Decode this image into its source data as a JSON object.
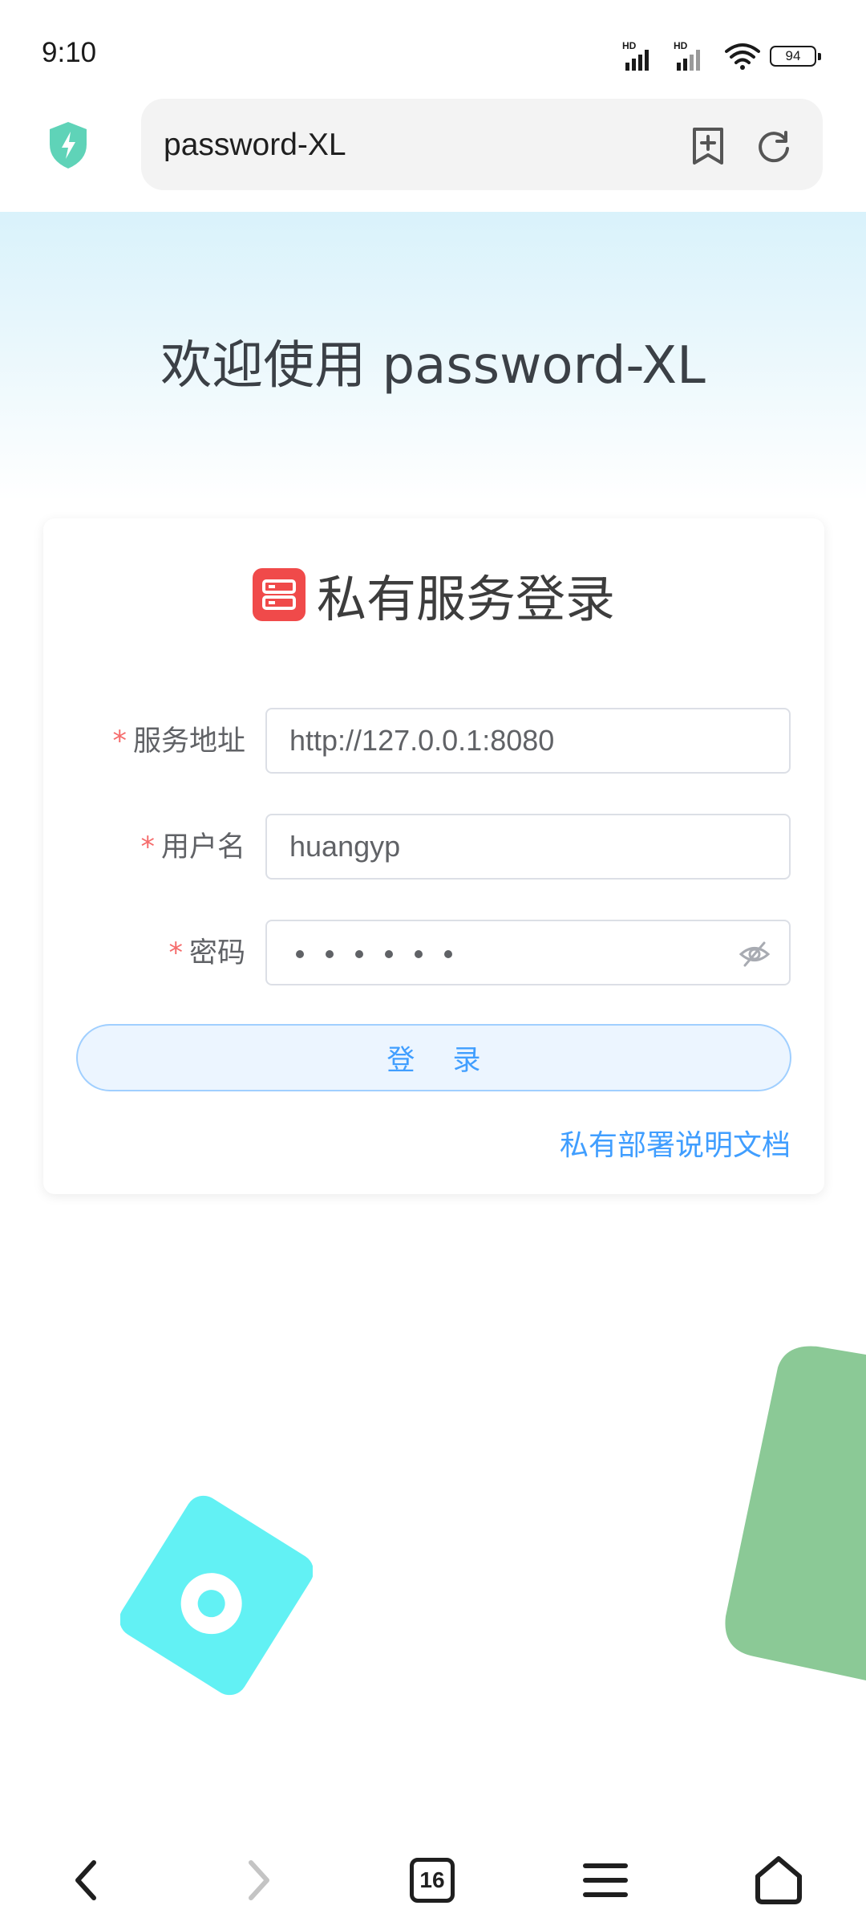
{
  "status_bar": {
    "time": "9:10",
    "signal1_label": "HD",
    "signal2_label": "HD",
    "battery_level": "94"
  },
  "browser": {
    "address": "password-XL",
    "icons": [
      "shield-icon",
      "bookmark-add-icon",
      "reload-icon"
    ]
  },
  "page": {
    "welcome_title": "欢迎使用 password-XL",
    "card_title": "私有服务登录",
    "form": {
      "required_mark": "*",
      "server_label": "服务地址",
      "server_value": "http://127.0.0.1:8080",
      "username_label": "用户名",
      "username_value": "huangyp",
      "password_label": "密码",
      "password_length": 6
    },
    "login_button": "登 录",
    "docs_link": "私有部署说明文档"
  },
  "colors": {
    "accent": "#409eff",
    "required": "#f56c6c",
    "server_icon": "#f04a4a",
    "deco_cyan": "#62f1f4",
    "deco_green": "#8bc996"
  },
  "bottom_nav": {
    "tab_count": "16",
    "icons": [
      "back-icon",
      "forward-icon",
      "tabs-icon",
      "menu-icon",
      "home-icon"
    ]
  }
}
